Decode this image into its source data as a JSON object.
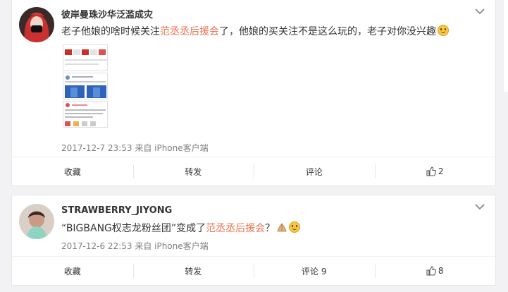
{
  "posts": [
    {
      "username": "彼岸曼珠沙华泛滥成灾",
      "text_before": "老子他娘的啥时候关注",
      "text_link": "范丞丞后援会",
      "text_after": "了，他娘的买关注不是这么玩的，老子对你没兴趣",
      "emoji": "smile-emoji",
      "meta": "2017-12-7 23:53 来自 iPhone客户端",
      "actions": {
        "favorite": "收藏",
        "repost": "转发",
        "comment": "评论",
        "like": "2"
      }
    },
    {
      "username": "STRAWBERRY_JIYONG",
      "text_before": "“BIGBANG权志龙粉丝团”变成了",
      "text_link": "范丞丞后援会",
      "text_after": "？",
      "emoji": "pray-emoji",
      "meta": "2017-12-6 22:53 来自 iPhone客户端",
      "actions": {
        "favorite": "收藏",
        "repost": "转发",
        "comment": "评论 9",
        "like": "8"
      }
    }
  ],
  "colors": {
    "link": "#eb7350",
    "meta": "#808080",
    "background": "#f2f2f5"
  }
}
